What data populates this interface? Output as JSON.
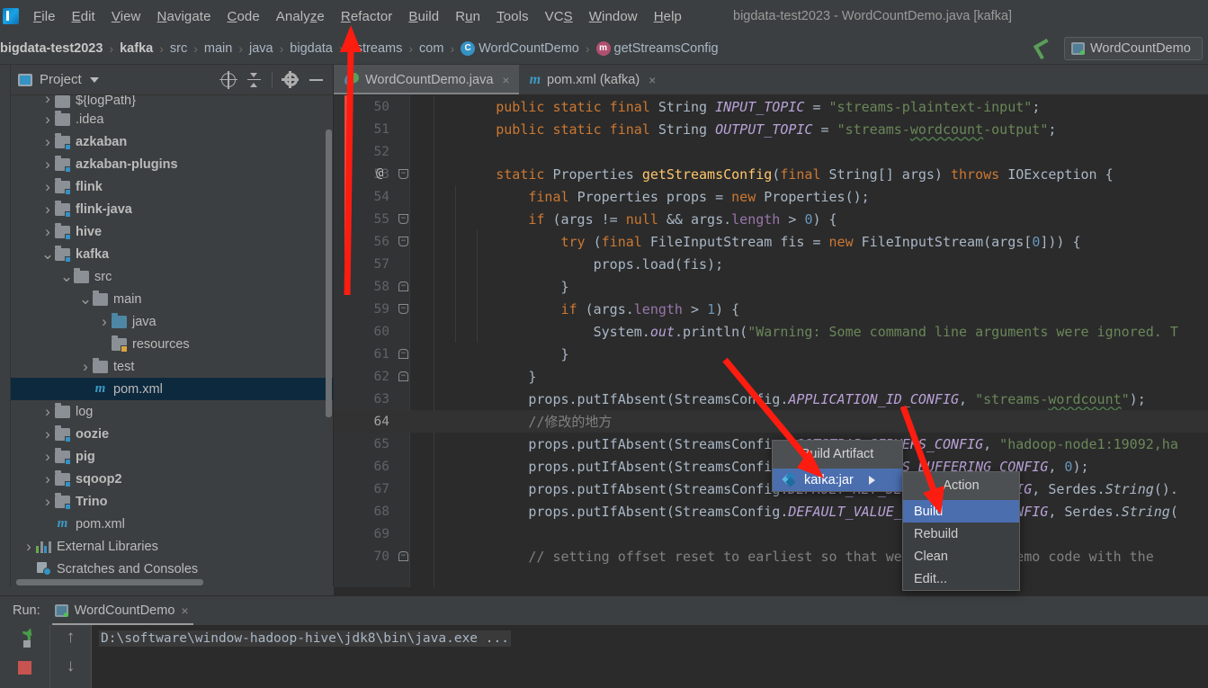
{
  "window": {
    "title": "bigdata-test2023 - WordCountDemo.java [kafka]",
    "app_icon": "intellij-idea-icon"
  },
  "menubar": {
    "items": [
      {
        "label": "File"
      },
      {
        "label": "Edit"
      },
      {
        "label": "View"
      },
      {
        "label": "Navigate"
      },
      {
        "label": "Code"
      },
      {
        "label": "Analyze"
      },
      {
        "label": "Refactor"
      },
      {
        "label": "Build"
      },
      {
        "label": "Run"
      },
      {
        "label": "Tools"
      },
      {
        "label": "VCS"
      },
      {
        "label": "Window"
      },
      {
        "label": "Help"
      }
    ]
  },
  "navbar": {
    "crumbs": [
      {
        "label": "bigdata-test2023",
        "bold": true,
        "icon": ""
      },
      {
        "label": "kafka",
        "bold": true,
        "icon": ""
      },
      {
        "label": "src",
        "bold": false,
        "icon": ""
      },
      {
        "label": "main",
        "bold": false,
        "icon": ""
      },
      {
        "label": "java",
        "bold": false,
        "icon": ""
      },
      {
        "label": "bigdata",
        "bold": false,
        "icon": ""
      },
      {
        "label": "kstreams",
        "bold": false,
        "icon": ""
      },
      {
        "label": "com",
        "bold": false,
        "icon": ""
      },
      {
        "label": "WordCountDemo",
        "bold": false,
        "icon": "class-icon"
      },
      {
        "label": "getStreamsConfig",
        "bold": false,
        "icon": "method-icon"
      }
    ],
    "separator": "›",
    "run_config_label": "WordCountDemo"
  },
  "project_panel": {
    "title": "Project",
    "tools": [
      "locate-icon",
      "collapse-all-icon",
      "settings-icon",
      "hide-icon"
    ],
    "tree": [
      {
        "label": "${logPath}",
        "depth": 1,
        "chev": "right",
        "icon": "folder-gray",
        "bold": false,
        "clipped": true
      },
      {
        "label": ".idea",
        "depth": 1,
        "chev": "right",
        "icon": "folder-gray",
        "bold": false
      },
      {
        "label": "azkaban",
        "depth": 1,
        "chev": "right",
        "icon": "folder-module",
        "bold": true
      },
      {
        "label": "azkaban-plugins",
        "depth": 1,
        "chev": "right",
        "icon": "folder-module",
        "bold": true
      },
      {
        "label": "flink",
        "depth": 1,
        "chev": "right",
        "icon": "folder-module",
        "bold": true
      },
      {
        "label": "flink-java",
        "depth": 1,
        "chev": "right",
        "icon": "folder-module",
        "bold": true
      },
      {
        "label": "hive",
        "depth": 1,
        "chev": "right",
        "icon": "folder-module",
        "bold": true
      },
      {
        "label": "kafka",
        "depth": 1,
        "chev": "down",
        "icon": "folder-module",
        "bold": true
      },
      {
        "label": "src",
        "depth": 2,
        "chev": "down",
        "icon": "folder-gray",
        "bold": false
      },
      {
        "label": "main",
        "depth": 3,
        "chev": "down",
        "icon": "folder-gray",
        "bold": false
      },
      {
        "label": "java",
        "depth": 4,
        "chev": "right",
        "icon": "folder-blue",
        "bold": false
      },
      {
        "label": "resources",
        "depth": 4,
        "chev": "none",
        "icon": "folder-resources",
        "bold": false
      },
      {
        "label": "test",
        "depth": 3,
        "chev": "right",
        "icon": "folder-gray",
        "bold": false
      },
      {
        "label": "pom.xml",
        "depth": 3,
        "chev": "none",
        "icon": "maven-icon",
        "bold": false,
        "selected": true
      },
      {
        "label": "log",
        "depth": 1,
        "chev": "right",
        "icon": "folder-gray",
        "bold": false
      },
      {
        "label": "oozie",
        "depth": 1,
        "chev": "right",
        "icon": "folder-module",
        "bold": true
      },
      {
        "label": "pig",
        "depth": 1,
        "chev": "right",
        "icon": "folder-module",
        "bold": true
      },
      {
        "label": "sqoop2",
        "depth": 1,
        "chev": "right",
        "icon": "folder-module",
        "bold": true
      },
      {
        "label": "Trino",
        "depth": 1,
        "chev": "right",
        "icon": "folder-module",
        "bold": true
      },
      {
        "label": "pom.xml",
        "depth": 1,
        "chev": "none",
        "icon": "maven-icon",
        "bold": false
      },
      {
        "label": "External Libraries",
        "depth": 0,
        "chev": "right",
        "icon": "library-icon",
        "bold": false
      },
      {
        "label": "Scratches and Consoles",
        "depth": 0,
        "chev": "none",
        "icon": "scratches-icon",
        "bold": false
      }
    ]
  },
  "editor": {
    "tabs": [
      {
        "label": "WordCountDemo.java",
        "icon": "java-file-icon",
        "active": true,
        "close": "×"
      },
      {
        "label": "pom.xml (kafka)",
        "icon": "maven-icon",
        "active": false,
        "close": "×"
      }
    ],
    "lines": [
      {
        "num": "50",
        "indent": 2,
        "segments": [
          {
            "t": "public static final ",
            "c": "kw"
          },
          {
            "t": "String ",
            "c": "plain"
          },
          {
            "t": "INPUT_TOPIC ",
            "c": "static"
          },
          {
            "t": "= ",
            "c": "plain"
          },
          {
            "t": "\"streams-plaintext-input\"",
            "c": "str"
          },
          {
            "t": ";",
            "c": "plain"
          }
        ]
      },
      {
        "num": "51",
        "indent": 2,
        "segments": [
          {
            "t": "public static final ",
            "c": "kw"
          },
          {
            "t": "String ",
            "c": "plain"
          },
          {
            "t": "OUTPUT_TOPIC ",
            "c": "static"
          },
          {
            "t": "= ",
            "c": "plain"
          },
          {
            "t": "\"streams-",
            "c": "str"
          },
          {
            "t": "wordcount",
            "c": "str-wavy"
          },
          {
            "t": "-output\"",
            "c": "str"
          },
          {
            "t": ";",
            "c": "plain"
          }
        ]
      },
      {
        "num": "52",
        "indent": 0,
        "segments": []
      },
      {
        "num": "53",
        "indent": 2,
        "at": true,
        "fold": "down",
        "segments": [
          {
            "t": "static ",
            "c": "kw"
          },
          {
            "t": "Properties ",
            "c": "plain"
          },
          {
            "t": "getStreamsConfig",
            "c": "fn"
          },
          {
            "t": "(",
            "c": "plain"
          },
          {
            "t": "final ",
            "c": "kw"
          },
          {
            "t": "String[] args) ",
            "c": "plain"
          },
          {
            "t": "throws ",
            "c": "kw"
          },
          {
            "t": "IOException {",
            "c": "plain"
          }
        ]
      },
      {
        "num": "54",
        "indent": 3,
        "segments": [
          {
            "t": "final ",
            "c": "kw"
          },
          {
            "t": "Properties props = ",
            "c": "plain"
          },
          {
            "t": "new ",
            "c": "kw"
          },
          {
            "t": "Properties();",
            "c": "plain"
          }
        ]
      },
      {
        "num": "55",
        "indent": 3,
        "fold": "down",
        "segments": [
          {
            "t": "if ",
            "c": "kw"
          },
          {
            "t": "(args != ",
            "c": "plain"
          },
          {
            "t": "null ",
            "c": "kw"
          },
          {
            "t": "&& args.",
            "c": "plain"
          },
          {
            "t": "length ",
            "c": "field"
          },
          {
            "t": "> ",
            "c": "plain"
          },
          {
            "t": "0",
            "c": "num"
          },
          {
            "t": ") {",
            "c": "plain"
          }
        ]
      },
      {
        "num": "56",
        "indent": 4,
        "fold": "down",
        "segments": [
          {
            "t": "try ",
            "c": "kw"
          },
          {
            "t": "(",
            "c": "plain"
          },
          {
            "t": "final ",
            "c": "kw"
          },
          {
            "t": "FileInputStream fis = ",
            "c": "plain"
          },
          {
            "t": "new ",
            "c": "kw"
          },
          {
            "t": "FileInputStream(args[",
            "c": "plain"
          },
          {
            "t": "0",
            "c": "num"
          },
          {
            "t": "])) {",
            "c": "plain"
          }
        ]
      },
      {
        "num": "57",
        "indent": 5,
        "segments": [
          {
            "t": "props.load(fis);",
            "c": "plain"
          }
        ]
      },
      {
        "num": "58",
        "indent": 4,
        "fold": "up",
        "segments": [
          {
            "t": "}",
            "c": "plain"
          }
        ]
      },
      {
        "num": "59",
        "indent": 4,
        "fold": "down",
        "segments": [
          {
            "t": "if ",
            "c": "kw"
          },
          {
            "t": "(args.",
            "c": "plain"
          },
          {
            "t": "length ",
            "c": "field"
          },
          {
            "t": "> ",
            "c": "plain"
          },
          {
            "t": "1",
            "c": "num"
          },
          {
            "t": ") {",
            "c": "plain"
          }
        ]
      },
      {
        "num": "60",
        "indent": 5,
        "segments": [
          {
            "t": "System.",
            "c": "plain"
          },
          {
            "t": "out",
            "c": "static"
          },
          {
            "t": ".println(",
            "c": "plain"
          },
          {
            "t": "\"Warning: Some command line arguments were ignored. T",
            "c": "str"
          }
        ]
      },
      {
        "num": "61",
        "indent": 4,
        "fold": "up",
        "segments": [
          {
            "t": "}",
            "c": "plain"
          }
        ]
      },
      {
        "num": "62",
        "indent": 3,
        "fold": "up",
        "segments": [
          {
            "t": "}",
            "c": "plain"
          }
        ]
      },
      {
        "num": "63",
        "indent": 3,
        "segments": [
          {
            "t": "props.putIfAbsent(StreamsConfig.",
            "c": "plain"
          },
          {
            "t": "APPLICATION_ID_CONFIG",
            "c": "static"
          },
          {
            "t": ", ",
            "c": "plain"
          },
          {
            "t": "\"streams-",
            "c": "str"
          },
          {
            "t": "wordcount",
            "c": "str-wavy"
          },
          {
            "t": "\"",
            "c": "str"
          },
          {
            "t": ");",
            "c": "plain"
          }
        ]
      },
      {
        "num": "64",
        "indent": 3,
        "highlight": true,
        "segments": [
          {
            "t": "//修改的地方",
            "c": "comment"
          }
        ]
      },
      {
        "num": "65",
        "indent": 3,
        "segments": [
          {
            "t": "props.putIfAbsent(StreamsConfig.",
            "c": "plain"
          },
          {
            "t": "BOOTSTRAP_SERVERS_CONFIG",
            "c": "static"
          },
          {
            "t": ", ",
            "c": "plain"
          },
          {
            "t": "\"hadoop-node1:19092,ha",
            "c": "str"
          }
        ]
      },
      {
        "num": "66",
        "indent": 3,
        "segments": [
          {
            "t": "props.putIfAbsent(StreamsConfig.",
            "c": "plain"
          },
          {
            "t": "CACHE_MAX_BYTES_BUFFERING_CONFIG",
            "c": "static"
          },
          {
            "t": ", ",
            "c": "plain"
          },
          {
            "t": "0",
            "c": "num"
          },
          {
            "t": ");",
            "c": "plain"
          }
        ]
      },
      {
        "num": "67",
        "indent": 3,
        "segments": [
          {
            "t": "props.putIfAbsent(StreamsConfig.",
            "c": "plain"
          },
          {
            "t": "DEFAULT_KEY_SERDE_CLASS_CONFIG",
            "c": "static"
          },
          {
            "t": ", Serdes.",
            "c": "plain"
          },
          {
            "t": "String",
            "c": "plain-italic"
          },
          {
            "t": "().",
            "c": "plain"
          }
        ]
      },
      {
        "num": "68",
        "indent": 3,
        "segments": [
          {
            "t": "props.putIfAbsent(StreamsConfig.",
            "c": "plain"
          },
          {
            "t": "DEFAULT_VALUE_SERDE_CLASS_CONFIG",
            "c": "static"
          },
          {
            "t": ", Serdes.",
            "c": "plain"
          },
          {
            "t": "String",
            "c": "plain-italic"
          },
          {
            "t": "(",
            "c": "plain"
          }
        ]
      },
      {
        "num": "69",
        "indent": 0,
        "segments": []
      },
      {
        "num": "70",
        "indent": 3,
        "fold": "up",
        "segments": [
          {
            "t": "// setting offset reset to earliest so that we can run the demo code with the",
            "c": "comment"
          }
        ]
      }
    ]
  },
  "popups": {
    "build_artifact": {
      "title": "Build Artifact",
      "items": [
        {
          "label": "kafka:jar",
          "icon": "artifact-icon",
          "selected": true,
          "has_submenu": true,
          "submenu_arrow": "▶"
        }
      ]
    },
    "action": {
      "title": "Action",
      "items": [
        {
          "label": "Build",
          "selected": true
        },
        {
          "label": "Rebuild",
          "selected": false
        },
        {
          "label": "Clean",
          "selected": false
        },
        {
          "label": "Edit...",
          "selected": false
        }
      ]
    }
  },
  "run_panel": {
    "label": "Run:",
    "tab_label": "WordCountDemo",
    "tab_close": "×",
    "buttons": [
      "rerun-icon",
      "stop-icon",
      "up-arrow-icon",
      "down-arrow-icon"
    ],
    "up_arrow": "↑",
    "down_arrow": "↓",
    "console_output": "D:\\software\\window-hadoop-hive\\jdk8\\bin\\java.exe ..."
  },
  "annotations": {
    "color": "#fc1c10",
    "arrows": [
      {
        "name": "arrow-to-refactor-menu"
      },
      {
        "name": "arrow-to-kafka-jar-item"
      },
      {
        "name": "arrow-to-build-item"
      }
    ]
  },
  "colors": {
    "background": "#3c3f41",
    "editor_bg": "#2b2b2b",
    "selection_blue": "#4b6eaf",
    "tree_selection": "#0d293e",
    "annotation_red": "#fc1c10",
    "accent_blue": "#3592c4"
  }
}
